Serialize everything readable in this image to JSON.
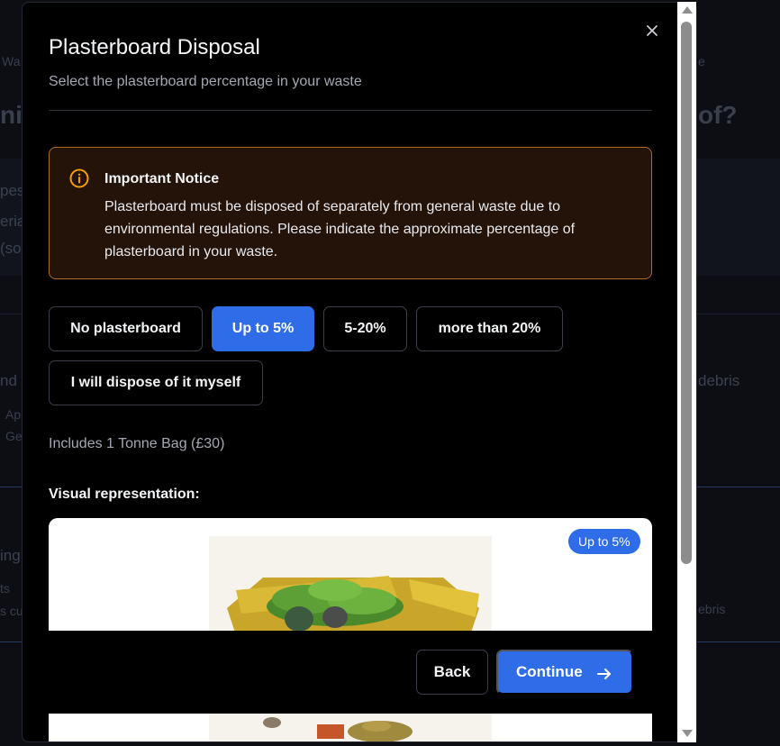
{
  "background": {
    "frag_wa": "Wa",
    "frag_e": "e",
    "frag_nic": "nic",
    "frag_of": "of?",
    "frag_pes": "pes",
    "frag_eria": "eria",
    "frag_so": "(so",
    "frag_nd": "nd",
    "frag_debris1": "debris",
    "frag_ap": "Ap",
    "frag_ge": "Ge",
    "frag_ing": "ing",
    "frag_ts": "ts",
    "frag_scu": "s cu",
    "frag_debris2": "ebris"
  },
  "modal": {
    "title": "Plasterboard Disposal",
    "subtitle": "Select the plasterboard percentage in your waste",
    "close_label": "×",
    "notice": {
      "title": "Important Notice",
      "body": "Plasterboard must be disposed of separately from general waste due to environmental regulations. Please indicate the approximate percentage of plasterboard in your waste.",
      "icon": "info-circle-icon",
      "accent_color": "#f59e0b"
    },
    "options": [
      {
        "label": "No plasterboard",
        "selected": false
      },
      {
        "label": "Up to 5%",
        "selected": true
      },
      {
        "label": "5-20%",
        "selected": false
      },
      {
        "label": "more than 20%",
        "selected": false
      },
      {
        "label": "I will dispose of it myself",
        "selected": false
      }
    ],
    "includes_text": "Includes 1 Tonne Bag (£30)",
    "visual_label": "Visual representation:",
    "image_badge": "Up to 5%",
    "footer": {
      "back_label": "Back",
      "continue_label": "Continue"
    }
  },
  "colors": {
    "accent": "#2f6ce8",
    "notice_border": "#b46a1c"
  }
}
